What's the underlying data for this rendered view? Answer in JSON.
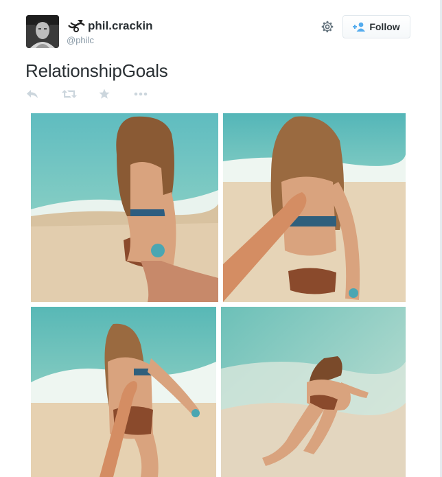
{
  "user": {
    "display_name": "phil.crackin",
    "handle": "@philc",
    "avatar_icon": "profile-photo"
  },
  "header": {
    "follow_label": "Follow",
    "settings_icon": "gear-icon"
  },
  "tweet": {
    "text": "RelationshipGoals"
  },
  "actions": [
    {
      "icon": "reply-icon"
    },
    {
      "icon": "retweet-icon"
    },
    {
      "icon": "favorite-star-icon"
    },
    {
      "icon": "more-dots-icon"
    }
  ],
  "media": {
    "photos": [
      {
        "name": "beach-photo-1"
      },
      {
        "name": "beach-photo-2"
      },
      {
        "name": "beach-photo-3"
      },
      {
        "name": "beach-photo-4"
      }
    ]
  },
  "colors": {
    "link_blue": "#55acee",
    "secondary_text": "#8899a6",
    "primary_text": "#292f33",
    "sea": "#4fb3b0",
    "sand": "#e6d2b5"
  }
}
